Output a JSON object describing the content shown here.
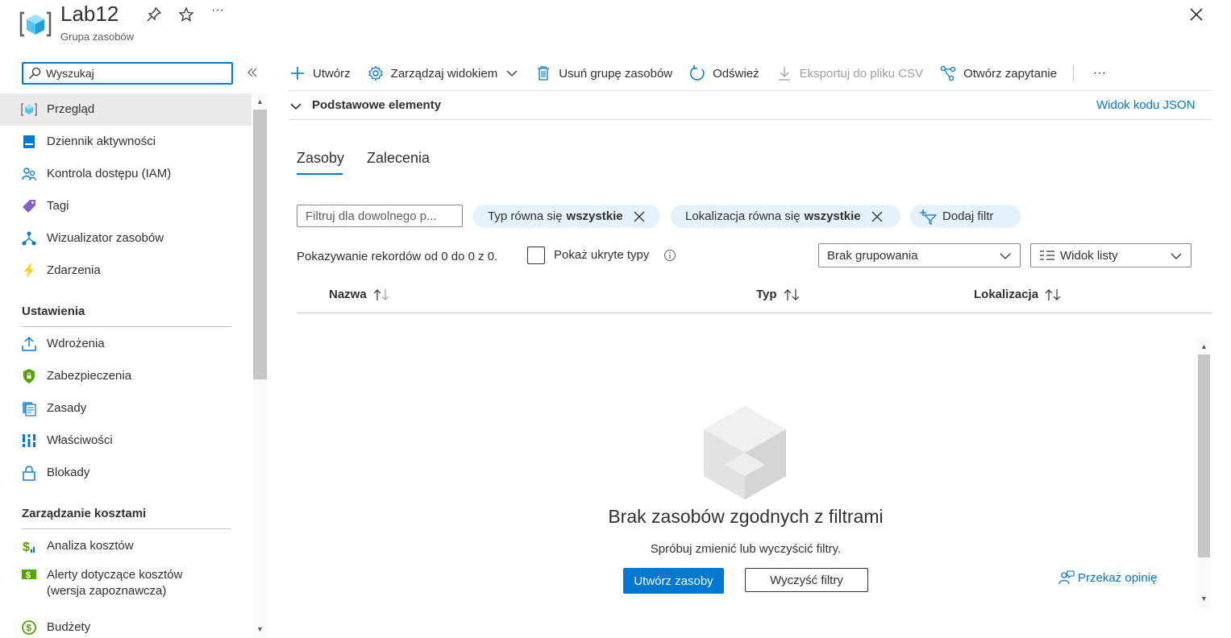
{
  "header": {
    "title": "Lab12",
    "subtitle": "Grupa zasobów",
    "more": "···"
  },
  "sidebar": {
    "search_placeholder": "Wyszukaj",
    "items": [
      {
        "label": "Przegląd",
        "icon": "resource-group-icon",
        "active": true
      },
      {
        "label": "Dziennik aktywności",
        "icon": "activity-log-icon"
      },
      {
        "label": "Kontrola dostępu (IAM)",
        "icon": "iam-icon"
      },
      {
        "label": "Tagi",
        "icon": "tag-icon"
      },
      {
        "label": "Wizualizator zasobów",
        "icon": "visualizer-icon"
      },
      {
        "label": "Zdarzenia",
        "icon": "lightning-icon"
      }
    ],
    "section_settings": "Ustawienia",
    "settings_items": [
      {
        "label": "Wdrożenia",
        "icon": "deployments-icon"
      },
      {
        "label": "Zabezpieczenia",
        "icon": "security-shield-icon"
      },
      {
        "label": "Zasady",
        "icon": "policies-icon"
      },
      {
        "label": "Właściwości",
        "icon": "properties-icon"
      },
      {
        "label": "Blokady",
        "icon": "lock-icon"
      }
    ],
    "section_cost": "Zarządzanie kosztami",
    "cost_items": [
      {
        "label": "Analiza kosztów",
        "icon": "cost-analysis-icon"
      },
      {
        "label_line1": "Alerty dotyczące kosztów",
        "label_line2": "(wersja zapoznawcza)",
        "icon": "cost-alerts-icon"
      },
      {
        "label": "Budżety",
        "icon": "budgets-icon"
      }
    ]
  },
  "toolbar": {
    "create": "Utwórz",
    "manage_view": "Zarządzaj widokiem",
    "delete_group": "Usuń grupę zasobów",
    "refresh": "Odśwież",
    "export_csv": "Eksportuj do pliku CSV",
    "open_query": "Otwórz zapytanie",
    "more": "···"
  },
  "essentials": {
    "label": "Podstawowe elementy",
    "json_link": "Widok kodu JSON"
  },
  "tabs": [
    {
      "label": "Zasoby",
      "active": true
    },
    {
      "label": "Zalecenia"
    }
  ],
  "filters": {
    "input_placeholder": "Filtruj dla dowolnego p...",
    "type_prefix": "Typ równa się",
    "type_value": "wszystkie",
    "location_prefix": "Lokalizacja równa się",
    "location_value": "wszystkie",
    "add_filter": "Dodaj filtr"
  },
  "records": {
    "text": "Pokazywanie rekordów od 0 do 0 z 0.",
    "show_hidden": "Pokaż ukryte typy",
    "show_hidden_checked": false
  },
  "grouping": {
    "selected": "Brak grupowania"
  },
  "view_mode": {
    "selected": "Widok listy"
  },
  "table": {
    "columns": [
      "Nazwa",
      "Typ",
      "Lokalizacja"
    ]
  },
  "empty_state": {
    "title": "Brak zasobów zgodnych z filtrami",
    "subtitle": "Spróbuj zmienić lub wyczyścić filtry.",
    "create_button": "Utwórz zasoby",
    "clear_button": "Wyczyść filtry"
  },
  "feedback": "Przekaż opinię",
  "colors": {
    "accent": "#0078d4",
    "pill_bg": "#e5f1fb",
    "active_nav_bg": "#edebe9"
  }
}
